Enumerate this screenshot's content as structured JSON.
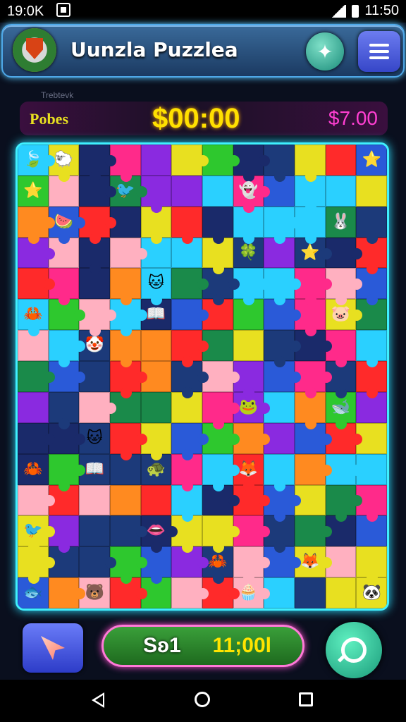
{
  "status_bar": {
    "time": "19:0K",
    "right_time": "11:50"
  },
  "header": {
    "title": "Uunzla Puzzlea",
    "x_button_icon": "sparkle-icon",
    "menu_button_icon": "hamburger-menu-icon"
  },
  "faint_label": "Trebtevk",
  "score": {
    "left_label": "Pobes",
    "center_value": "$00:00",
    "right_value": "$7.00"
  },
  "board": {
    "cols": 12,
    "rows": 15,
    "palette": [
      "#1a2a6a",
      "#1c3a7a",
      "#e8e020",
      "#ff8a20",
      "#ff2a8a",
      "#2ad0ff",
      "#2ec82e",
      "#8a2ae0",
      "#ff2a2a",
      "#ffb0c0",
      "#1a8a4a",
      "#2a5ad8"
    ],
    "icons": [
      {
        "r": 0,
        "c": 0,
        "glyph": "🍃"
      },
      {
        "r": 0,
        "c": 1,
        "glyph": "🐑"
      },
      {
        "r": 0,
        "c": 11,
        "glyph": "⭐"
      },
      {
        "r": 1,
        "c": 0,
        "glyph": "⭐"
      },
      {
        "r": 1,
        "c": 3,
        "glyph": "🐦"
      },
      {
        "r": 1,
        "c": 7,
        "glyph": "👻"
      },
      {
        "r": 2,
        "c": 1,
        "glyph": "🍉"
      },
      {
        "r": 2,
        "c": 10,
        "glyph": "🐰"
      },
      {
        "r": 3,
        "c": 7,
        "glyph": "🍀"
      },
      {
        "r": 3,
        "c": 9,
        "glyph": "⭐"
      },
      {
        "r": 4,
        "c": 4,
        "glyph": "🐱"
      },
      {
        "r": 5,
        "c": 0,
        "glyph": "🦀"
      },
      {
        "r": 5,
        "c": 4,
        "glyph": "📖"
      },
      {
        "r": 5,
        "c": 10,
        "glyph": "🐷"
      },
      {
        "r": 6,
        "c": 2,
        "glyph": "🤡"
      },
      {
        "r": 8,
        "c": 7,
        "glyph": "🐸"
      },
      {
        "r": 8,
        "c": 10,
        "glyph": "🐋"
      },
      {
        "r": 9,
        "c": 2,
        "glyph": "🐱"
      },
      {
        "r": 10,
        "c": 0,
        "glyph": "🦀"
      },
      {
        "r": 10,
        "c": 2,
        "glyph": "📖"
      },
      {
        "r": 10,
        "c": 4,
        "glyph": "🐢"
      },
      {
        "r": 10,
        "c": 7,
        "glyph": "🦊"
      },
      {
        "r": 12,
        "c": 0,
        "glyph": "🐦"
      },
      {
        "r": 12,
        "c": 4,
        "glyph": "👄"
      },
      {
        "r": 13,
        "c": 6,
        "glyph": "🦀"
      },
      {
        "r": 13,
        "c": 9,
        "glyph": "🦊"
      },
      {
        "r": 14,
        "c": 0,
        "glyph": "🐟"
      },
      {
        "r": 14,
        "c": 2,
        "glyph": "🐻"
      },
      {
        "r": 14,
        "c": 7,
        "glyph": "🧁"
      },
      {
        "r": 14,
        "c": 11,
        "glyph": "🐼"
      }
    ]
  },
  "bottom": {
    "hint_icon": "cursor-arrow-icon",
    "timer_left": "Sʚ1",
    "timer_right": "11;00l",
    "search_icon": "search-icon"
  },
  "nav": {
    "back_icon": "back-icon",
    "home_icon": "home-icon",
    "recent_icon": "recent-apps-icon"
  }
}
